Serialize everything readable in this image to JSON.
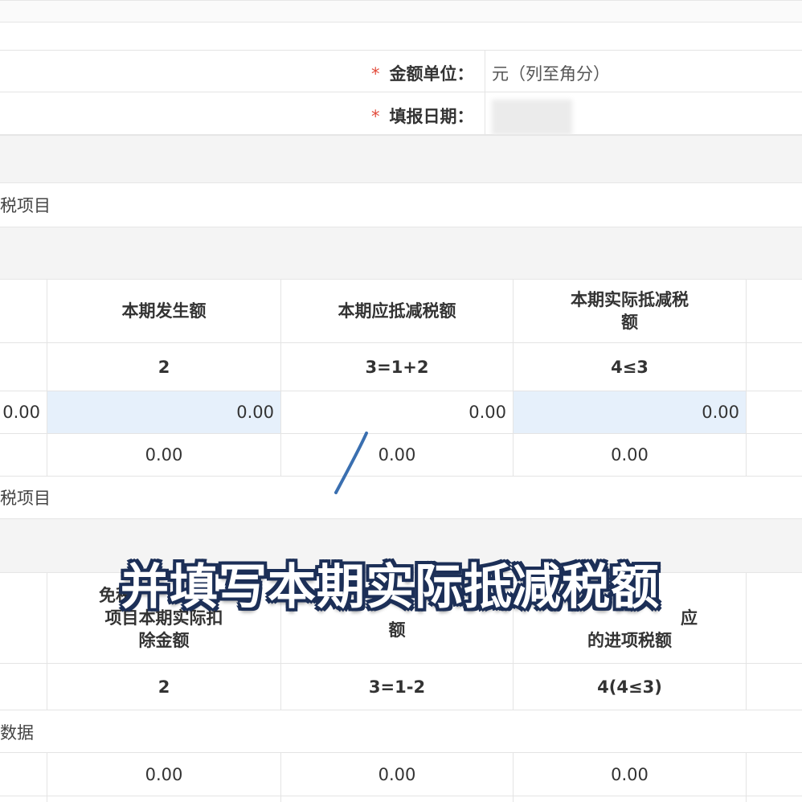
{
  "form": {
    "amount_unit_label": "金额单位：",
    "amount_unit_value": "元（列至角分）",
    "fill_date_label": "填报日期：",
    "required_mark": "*"
  },
  "section1": {
    "title": "税项目"
  },
  "table1": {
    "headers": [
      "本期发生额",
      "本期应抵减税额",
      "本期实际抵减税\n额"
    ],
    "codes": [
      "2",
      "3=1+2",
      "4≤3"
    ],
    "row1": [
      "0.00",
      "0.00",
      "0.00",
      "0.00"
    ],
    "row2": [
      "0.00",
      "0.00",
      "0.00"
    ]
  },
  "section2": {
    "title": "税项目"
  },
  "table2": {
    "headers": [
      "免税\n项目本期实际扣\n除金额",
      "额",
      "应\n的进项税额"
    ],
    "codes": [
      "2",
      "3=1-2",
      "4(4≤3)"
    ]
  },
  "section3": {
    "title": "数据"
  },
  "table3": {
    "row1": [
      "0.00",
      "0.00",
      "0.00"
    ]
  },
  "caption": "并填写本期实际抵减税额",
  "colors": {
    "accent_blue": "#e6f0fb",
    "required_red": "#e24b3b",
    "caption_outline": "#1c2f57"
  }
}
